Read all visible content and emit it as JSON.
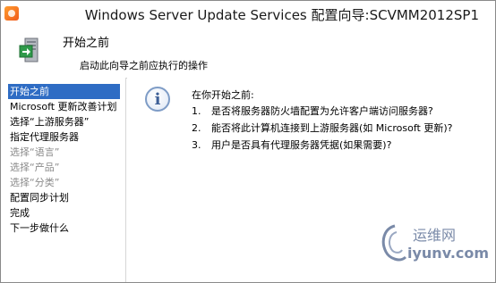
{
  "window": {
    "title": "Windows Server Update Services 配置向导:SCVMM2012SP1"
  },
  "header": {
    "title": "开始之前",
    "subtitle": "启动此向导之前应执行的操作"
  },
  "nav": {
    "items": [
      {
        "label": "开始之前",
        "state": "active"
      },
      {
        "label": "Microsoft 更新改善计划",
        "state": "normal"
      },
      {
        "label": "选择“上游服务器”",
        "state": "normal"
      },
      {
        "label": "指定代理服务器",
        "state": "normal"
      },
      {
        "label": "选择“语言”",
        "state": "disabled"
      },
      {
        "label": "选择“产品”",
        "state": "disabled"
      },
      {
        "label": "选择“分类”",
        "state": "disabled"
      },
      {
        "label": "配置同步计划",
        "state": "normal"
      },
      {
        "label": "完成",
        "state": "normal"
      },
      {
        "label": "下一步做什么",
        "state": "normal"
      }
    ]
  },
  "content": {
    "intro": "在你开始之前:",
    "questions": [
      {
        "num": "1.",
        "text": "是否将服务器防火墙配置为允许客户端访问服务器?"
      },
      {
        "num": "2.",
        "text": "能否将此计算机连接到上游服务器(如 Microsoft 更新)?"
      },
      {
        "num": "3.",
        "text": "用户是否具有代理服务器凭据(如果需要)?"
      }
    ]
  },
  "watermark": {
    "cn": "运维网",
    "url": "iyunv.com"
  },
  "colors": {
    "accent": "#2e6cc4",
    "disabled_text": "#8a8a8a"
  },
  "icons": {
    "app": "wsus-app-icon",
    "wizard": "server-update-icon",
    "info": "info-icon"
  }
}
